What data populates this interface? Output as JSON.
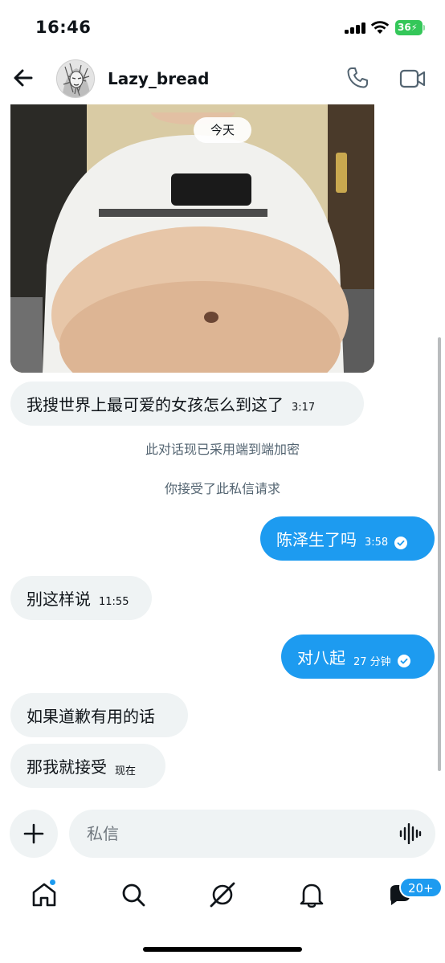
{
  "status_bar": {
    "time": "16:46",
    "battery": "36"
  },
  "header": {
    "username": "Lazy_bread"
  },
  "date_separator": "今天",
  "messages": [
    {
      "direction": "in",
      "text": "我搜世界上最可爱的女孩怎么到这了",
      "time": "3:17"
    },
    {
      "direction": "out",
      "text": "陈泽生了吗",
      "time": "3:58"
    },
    {
      "direction": "in",
      "text": "别这样说",
      "time": "11:55"
    },
    {
      "direction": "out",
      "text": "对八起",
      "time": "27 分钟"
    },
    {
      "direction": "in",
      "text": "如果道歉有用的话",
      "time": ""
    },
    {
      "direction": "in",
      "text": "那我就接受",
      "time": "现在"
    }
  ],
  "system_notes": [
    "此对话现已采用端到端加密",
    "你接受了此私信请求"
  ],
  "composer": {
    "placeholder": "私信"
  },
  "nav": {
    "messages_badge": "20+"
  },
  "colors": {
    "accent": "#1d9bf0",
    "incoming_bubble": "#eff3f4"
  }
}
